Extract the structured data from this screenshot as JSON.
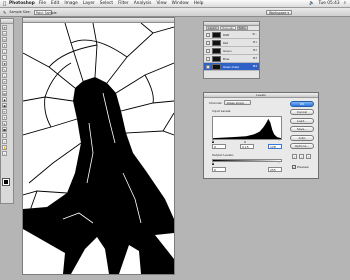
{
  "menubar": {
    "apple": "",
    "app_name": "Photoshop",
    "items": [
      "File",
      "Edit",
      "Image",
      "Layer",
      "Select",
      "Filter",
      "Analysis",
      "View",
      "Window",
      "Help"
    ],
    "clock": "Tue 05:43"
  },
  "options_bar": {
    "sample_label": "Sample Size:",
    "sample_value": "Point Sample",
    "workspace_label": "Workspace ▾"
  },
  "layers_panel": {
    "tabs": [
      "Layers",
      "Channels",
      "Paths"
    ],
    "channels": [
      {
        "name": "RGB",
        "shortcut": "⌘~"
      },
      {
        "name": "Red",
        "shortcut": "⌘1"
      },
      {
        "name": "Green",
        "shortcut": "⌘2"
      },
      {
        "name": "Blue",
        "shortcut": "⌘3"
      },
      {
        "name": "Glass sharp",
        "shortcut": "⌘4"
      }
    ]
  },
  "levels_dialog": {
    "title": "Levels",
    "channel_label": "Channel:",
    "channel_value": "Glass sharp",
    "input_levels_label": "Input Levels:",
    "input_black": "0",
    "input_gamma": "0.15",
    "input_white": "128",
    "output_levels_label": "Output Levels:",
    "output_black": "0",
    "output_white": "255",
    "buttons": {
      "ok": "OK",
      "cancel": "Cancel",
      "load": "Load...",
      "save": "Save...",
      "auto": "Auto",
      "options": "Options..."
    },
    "preview_label": "Preview",
    "preview_checked": true
  },
  "colors": {
    "selection": "#2f62c9",
    "default_button": "#2f77db"
  }
}
